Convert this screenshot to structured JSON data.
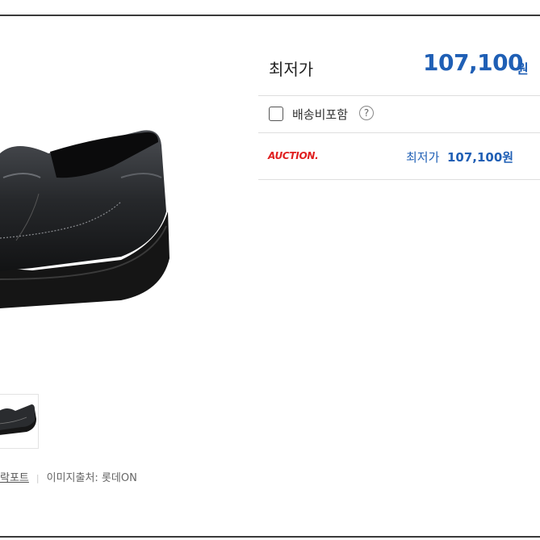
{
  "price_panel": {
    "lowest_label": "최저가",
    "lowest_price": "107,100",
    "lowest_unit": "원",
    "shipping_label": "배송비포함",
    "help_icon": "?"
  },
  "sellers": [
    {
      "logo_text": "AUCTION.",
      "price_label": "최저가",
      "price": "107,100원"
    }
  ],
  "product": {
    "brand": "락포트",
    "image_source": "이미지출처: 롯데ON"
  },
  "colors": {
    "accent_blue": "#1f5fb5",
    "auction_red": "#e02020"
  }
}
